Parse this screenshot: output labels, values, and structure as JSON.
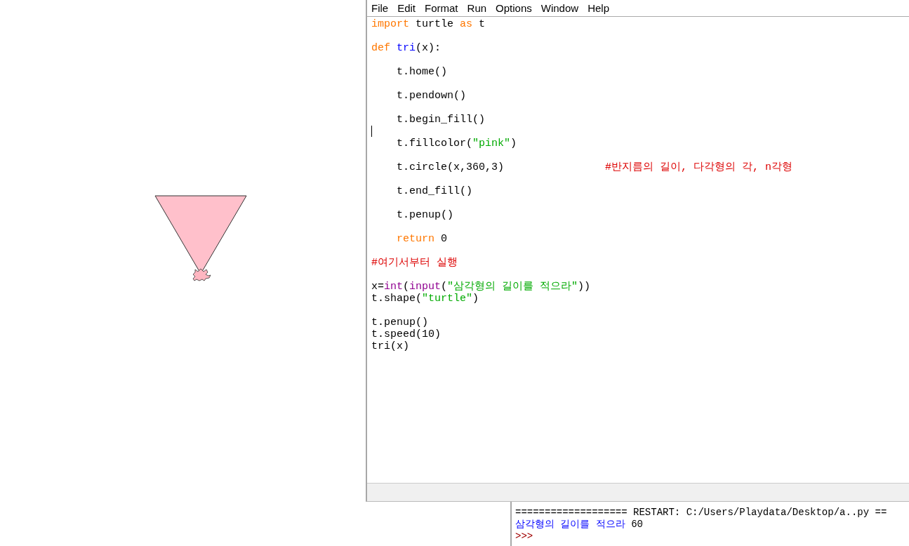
{
  "editor": {
    "menu": [
      "File",
      "Edit",
      "Format",
      "Run",
      "Options",
      "Window",
      "Help"
    ],
    "blocks": [
      {
        "lines": [
          [
            {
              "text": "import",
              "kind": "keyword"
            },
            {
              "text": " turtle ",
              "kind": "plain"
            },
            {
              "text": "as",
              "kind": "keyword"
            },
            {
              "text": " t",
              "kind": "plain"
            }
          ]
        ]
      },
      {
        "lines": [
          [
            {
              "text": "def",
              "kind": "keyword"
            },
            {
              "text": " tri",
              "kind": "name"
            },
            {
              "text": "(x):",
              "kind": "plain"
            }
          ]
        ]
      },
      {
        "lines": [
          [
            {
              "text": "    t.home()",
              "kind": "plain"
            }
          ]
        ]
      },
      {
        "lines": [
          [
            {
              "text": "    t.pendown()",
              "kind": "plain"
            }
          ]
        ]
      },
      {
        "lines": [
          [
            {
              "text": "    t.begin_fill()",
              "kind": "plain"
            }
          ]
        ]
      },
      {
        "lines": [
          [
            {
              "text": "    t.fillcolor(",
              "kind": "plain"
            },
            {
              "text": "\"pink\"",
              "kind": "string"
            },
            {
              "text": ")",
              "kind": "plain"
            }
          ]
        ]
      },
      {
        "lines": [
          [
            {
              "text": "    t.circle(x,360,3)                ",
              "kind": "plain"
            },
            {
              "text": "#반지름의 길이, 다각형의 각, n각형",
              "kind": "comment"
            }
          ]
        ]
      },
      {
        "lines": [
          [
            {
              "text": "    t.end_fill()",
              "kind": "plain"
            }
          ]
        ]
      },
      {
        "lines": [
          [
            {
              "text": "    t.penup()",
              "kind": "plain"
            }
          ]
        ]
      },
      {
        "lines": [
          [
            {
              "text": "    return",
              "kind": "keyword"
            },
            {
              "text": " 0",
              "kind": "plain"
            }
          ]
        ]
      },
      {
        "lines": [
          [
            {
              "text": "#여기서부터 실행",
              "kind": "comment"
            }
          ]
        ]
      },
      {
        "lines": [
          [
            {
              "text": "x=",
              "kind": "plain"
            },
            {
              "text": "int",
              "kind": "builtin"
            },
            {
              "text": "(",
              "kind": "plain"
            },
            {
              "text": "input",
              "kind": "builtin"
            },
            {
              "text": "(",
              "kind": "plain"
            },
            {
              "text": "\"삼각형의 길이를 적으라\"",
              "kind": "string"
            },
            {
              "text": "))",
              "kind": "plain"
            }
          ],
          [
            {
              "text": "t.shape(",
              "kind": "plain"
            },
            {
              "text": "\"turtle\"",
              "kind": "string"
            },
            {
              "text": ")",
              "kind": "plain"
            }
          ]
        ]
      },
      {
        "lines": [
          [
            {
              "text": "t.penup()",
              "kind": "plain"
            }
          ],
          [
            {
              "text": "t.speed(10)",
              "kind": "plain"
            }
          ],
          [
            {
              "text": "tri(x)",
              "kind": "plain"
            }
          ]
        ]
      }
    ]
  },
  "shell": {
    "lines": [
      [
        {
          "text": "=================== RESTART: C:/Users/Playdata/Desktop/a..py ==",
          "kind": "plain"
        }
      ],
      [
        {
          "text": "삼각형의 길이를 적으라",
          "kind": "output"
        },
        {
          "text": " 60",
          "kind": "plain"
        }
      ],
      [
        {
          "text": ">>>",
          "kind": "prompt"
        }
      ]
    ]
  }
}
